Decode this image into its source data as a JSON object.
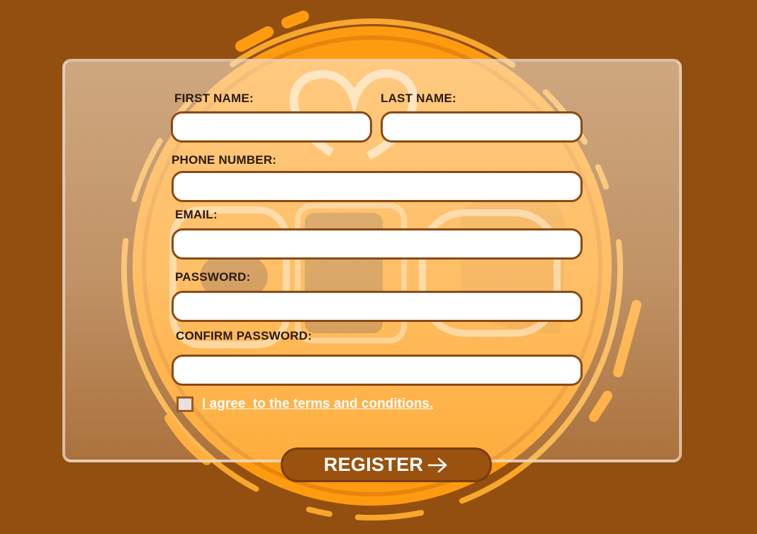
{
  "form": {
    "first_name": {
      "label": "FIRST NAME:",
      "value": ""
    },
    "last_name": {
      "label": "LAST NAME:",
      "value": ""
    },
    "phone": {
      "label": "PHONE NUMBER:",
      "value": ""
    },
    "email": {
      "label": "EMAIL:",
      "value": ""
    },
    "password": {
      "label": "PASSWORD:",
      "value": ""
    },
    "confirm_password": {
      "label": "CONFIRM PASSWORD:",
      "value": ""
    }
  },
  "terms": {
    "label": "I agree  to the terms and conditions.",
    "checked": false
  },
  "register": {
    "label": "REGISTER",
    "icon": "arrow-right-icon"
  },
  "theme": {
    "background": "#934f10",
    "accent_orange": "#ff9b10",
    "input_border": "#8c4a12",
    "button": "#9a520e"
  }
}
